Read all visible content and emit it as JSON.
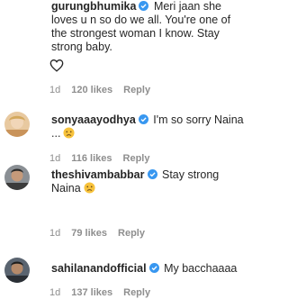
{
  "comments": [
    {
      "username": "gurungbhumika",
      "verified": true,
      "text": "Meri jaan she loves u n so do we all. You're one of the strongest woman I know. Stay strong baby.",
      "emoji": "",
      "time": "1d",
      "likes": "120 likes",
      "reply": "Reply"
    },
    {
      "username": "sonyaaayodhya",
      "verified": true,
      "text": "I'm so sorry Naina ...",
      "emoji": "disappointed-face-emoji",
      "time": "1d",
      "likes": "116 likes",
      "reply": "Reply"
    },
    {
      "username": "theshivambabbar",
      "verified": true,
      "text": "Stay strong Naina",
      "emoji": "disappointed-face-emoji",
      "time": "1d",
      "likes": "79 likes",
      "reply": "Reply"
    },
    {
      "username": "sahilanandofficial",
      "verified": true,
      "text": "My bacchaaaa",
      "emoji": "",
      "time": "1d",
      "likes": "137 likes",
      "reply": "Reply"
    }
  ],
  "colors": {
    "text": "#262626",
    "meta": "#8e8e8e",
    "verified": "#3897f0"
  }
}
